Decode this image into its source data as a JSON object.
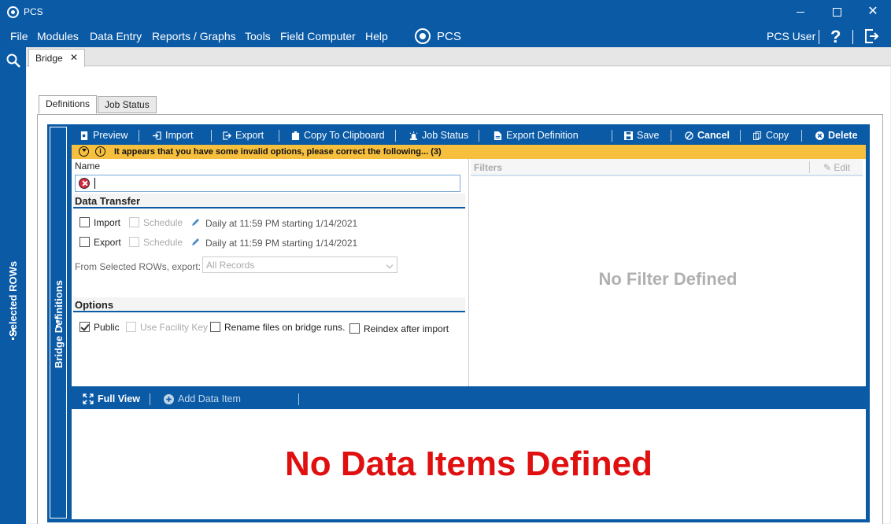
{
  "window": {
    "title": "PCS",
    "minimize": "",
    "maximize": "",
    "close": "✕"
  },
  "menu": {
    "items": [
      "File",
      "Modules",
      "Data Entry",
      "Reports / Graphs",
      "Tools",
      "Field Computer",
      "Help"
    ],
    "brand": "PCS",
    "user": "PCS User",
    "help": "?"
  },
  "side": {
    "selected_rows": "Selected ROWs",
    "bridge_definitions": "Bridge Definitions"
  },
  "doc_tab": {
    "label": "Bridge",
    "close": "✕"
  },
  "sub_tabs": [
    "Definitions",
    "Job Status"
  ],
  "toolbar": {
    "preview": "Preview",
    "import": "Import",
    "export": "Export",
    "copy_clipboard": "Copy To Clipboard",
    "job_status": "Job Status",
    "export_definition": "Export Definition",
    "save": "Save",
    "cancel": "Cancel",
    "copy": "Copy",
    "delete": "Delete"
  },
  "warning": {
    "message": "It appears that you have some invalid options, please correct the following...",
    "count": "(3)"
  },
  "form": {
    "name_label": "Name",
    "name_value": "",
    "data_transfer": "Data Transfer",
    "import_label": "Import",
    "export_label": "Export",
    "schedule_label": "Schedule",
    "import_schedule": "Daily at 11:59 PM starting 1/14/2021",
    "export_schedule": "Daily at 11:59 PM starting 1/14/2021",
    "from_selected": "From Selected ROWs, export:",
    "export_select": "All Records",
    "options": "Options",
    "public": "Public",
    "use_facility_key": "Use Facility Key",
    "rename_files": "Rename files on bridge runs.",
    "reindex": "Reindex after import"
  },
  "filters": {
    "title": "Filters",
    "edit": "Edit",
    "empty": "No Filter Defined"
  },
  "bottom": {
    "full_view": "Full View",
    "add_data_item": "Add Data Item",
    "empty": "No Data Items Defined"
  }
}
